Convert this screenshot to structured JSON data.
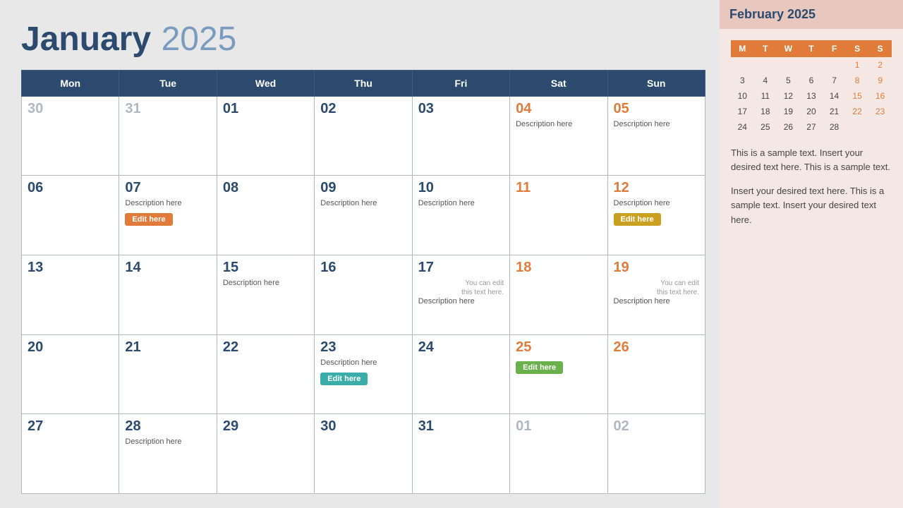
{
  "header": {
    "month": "January",
    "year": "2025"
  },
  "weekdays": [
    "Mon",
    "Tue",
    "Wed",
    "Thu",
    "Fri",
    "Sat",
    "Sun"
  ],
  "weeks": [
    [
      {
        "num": "30",
        "muted": true,
        "desc": "",
        "btn": null,
        "note": ""
      },
      {
        "num": "31",
        "muted": true,
        "desc": "",
        "btn": null,
        "note": ""
      },
      {
        "num": "01",
        "muted": false,
        "desc": "",
        "btn": null,
        "note": ""
      },
      {
        "num": "02",
        "muted": false,
        "desc": "",
        "btn": null,
        "note": ""
      },
      {
        "num": "03",
        "muted": false,
        "desc": "",
        "btn": null,
        "note": ""
      },
      {
        "num": "04",
        "muted": false,
        "highlight": true,
        "desc": "Description here",
        "btn": null,
        "note": ""
      },
      {
        "num": "05",
        "muted": false,
        "highlight": true,
        "desc": "Description here",
        "btn": null,
        "note": ""
      }
    ],
    [
      {
        "num": "06",
        "muted": false,
        "desc": "",
        "btn": null,
        "note": ""
      },
      {
        "num": "07",
        "muted": false,
        "desc": "Description here",
        "btn": "orange",
        "btnLabel": "Edit here",
        "note": ""
      },
      {
        "num": "08",
        "muted": false,
        "desc": "",
        "btn": null,
        "note": ""
      },
      {
        "num": "09",
        "muted": false,
        "desc": "Description here",
        "btn": null,
        "note": ""
      },
      {
        "num": "10",
        "muted": false,
        "desc": "Description here",
        "btn": null,
        "note": ""
      },
      {
        "num": "11",
        "muted": false,
        "highlight": true,
        "desc": "",
        "btn": null,
        "note": ""
      },
      {
        "num": "12",
        "muted": false,
        "highlight": true,
        "desc": "Description here",
        "btn": "amber",
        "btnLabel": "Edit here",
        "note": ""
      }
    ],
    [
      {
        "num": "13",
        "muted": false,
        "desc": "",
        "btn": null,
        "note": ""
      },
      {
        "num": "14",
        "muted": false,
        "desc": "",
        "btn": null,
        "note": ""
      },
      {
        "num": "15",
        "muted": false,
        "desc": "Description here",
        "btn": null,
        "note": ""
      },
      {
        "num": "16",
        "muted": false,
        "desc": "",
        "btn": null,
        "note": ""
      },
      {
        "num": "17",
        "muted": false,
        "desc": "Description here",
        "btn": null,
        "note": "You can edit this text here."
      },
      {
        "num": "18",
        "muted": false,
        "highlight": true,
        "desc": "",
        "btn": null,
        "note": ""
      },
      {
        "num": "19",
        "muted": false,
        "highlight": true,
        "desc": "Description here",
        "btn": null,
        "note": "You can edit this text here."
      }
    ],
    [
      {
        "num": "20",
        "muted": false,
        "desc": "",
        "btn": null,
        "note": ""
      },
      {
        "num": "21",
        "muted": false,
        "desc": "",
        "btn": null,
        "note": ""
      },
      {
        "num": "22",
        "muted": false,
        "desc": "",
        "btn": null,
        "note": ""
      },
      {
        "num": "23",
        "muted": false,
        "desc": "Description here",
        "btn": "teal",
        "btnLabel": "Edit here",
        "note": ""
      },
      {
        "num": "24",
        "muted": false,
        "desc": "",
        "btn": null,
        "note": ""
      },
      {
        "num": "25",
        "muted": false,
        "highlight": true,
        "desc": "",
        "btn": "green",
        "btnLabel": "Edit here",
        "note": ""
      },
      {
        "num": "26",
        "muted": false,
        "highlight": true,
        "desc": "",
        "btn": null,
        "note": ""
      }
    ],
    [
      {
        "num": "27",
        "muted": false,
        "desc": "",
        "btn": null,
        "note": ""
      },
      {
        "num": "28",
        "muted": false,
        "desc": "Description here",
        "btn": null,
        "note": ""
      },
      {
        "num": "29",
        "muted": false,
        "desc": "",
        "btn": null,
        "note": ""
      },
      {
        "num": "30",
        "muted": false,
        "desc": "",
        "btn": null,
        "note": ""
      },
      {
        "num": "31",
        "muted": false,
        "desc": "",
        "btn": null,
        "note": ""
      },
      {
        "num": "01",
        "muted": true,
        "desc": "",
        "btn": null,
        "note": ""
      },
      {
        "num": "02",
        "muted": true,
        "desc": "",
        "btn": null,
        "note": ""
      }
    ]
  ],
  "sidebar": {
    "title": "February 2025",
    "mini_headers": [
      "M",
      "T",
      "W",
      "T",
      "F",
      "S",
      "S"
    ],
    "mini_weeks": [
      [
        "",
        "",
        "",
        "",
        "",
        "1",
        "2"
      ],
      [
        "3",
        "4",
        "5",
        "6",
        "7",
        "8",
        "9"
      ],
      [
        "10",
        "11",
        "12",
        "13",
        "14",
        "15",
        "16"
      ],
      [
        "17",
        "18",
        "19",
        "20",
        "21",
        "22",
        "23"
      ],
      [
        "24",
        "25",
        "26",
        "27",
        "28",
        "",
        ""
      ]
    ],
    "text1": "This is a sample text. Insert your desired text here. This is a sample text.",
    "text2": "Insert your desired text here. This is a sample text. Insert your desired text here."
  }
}
